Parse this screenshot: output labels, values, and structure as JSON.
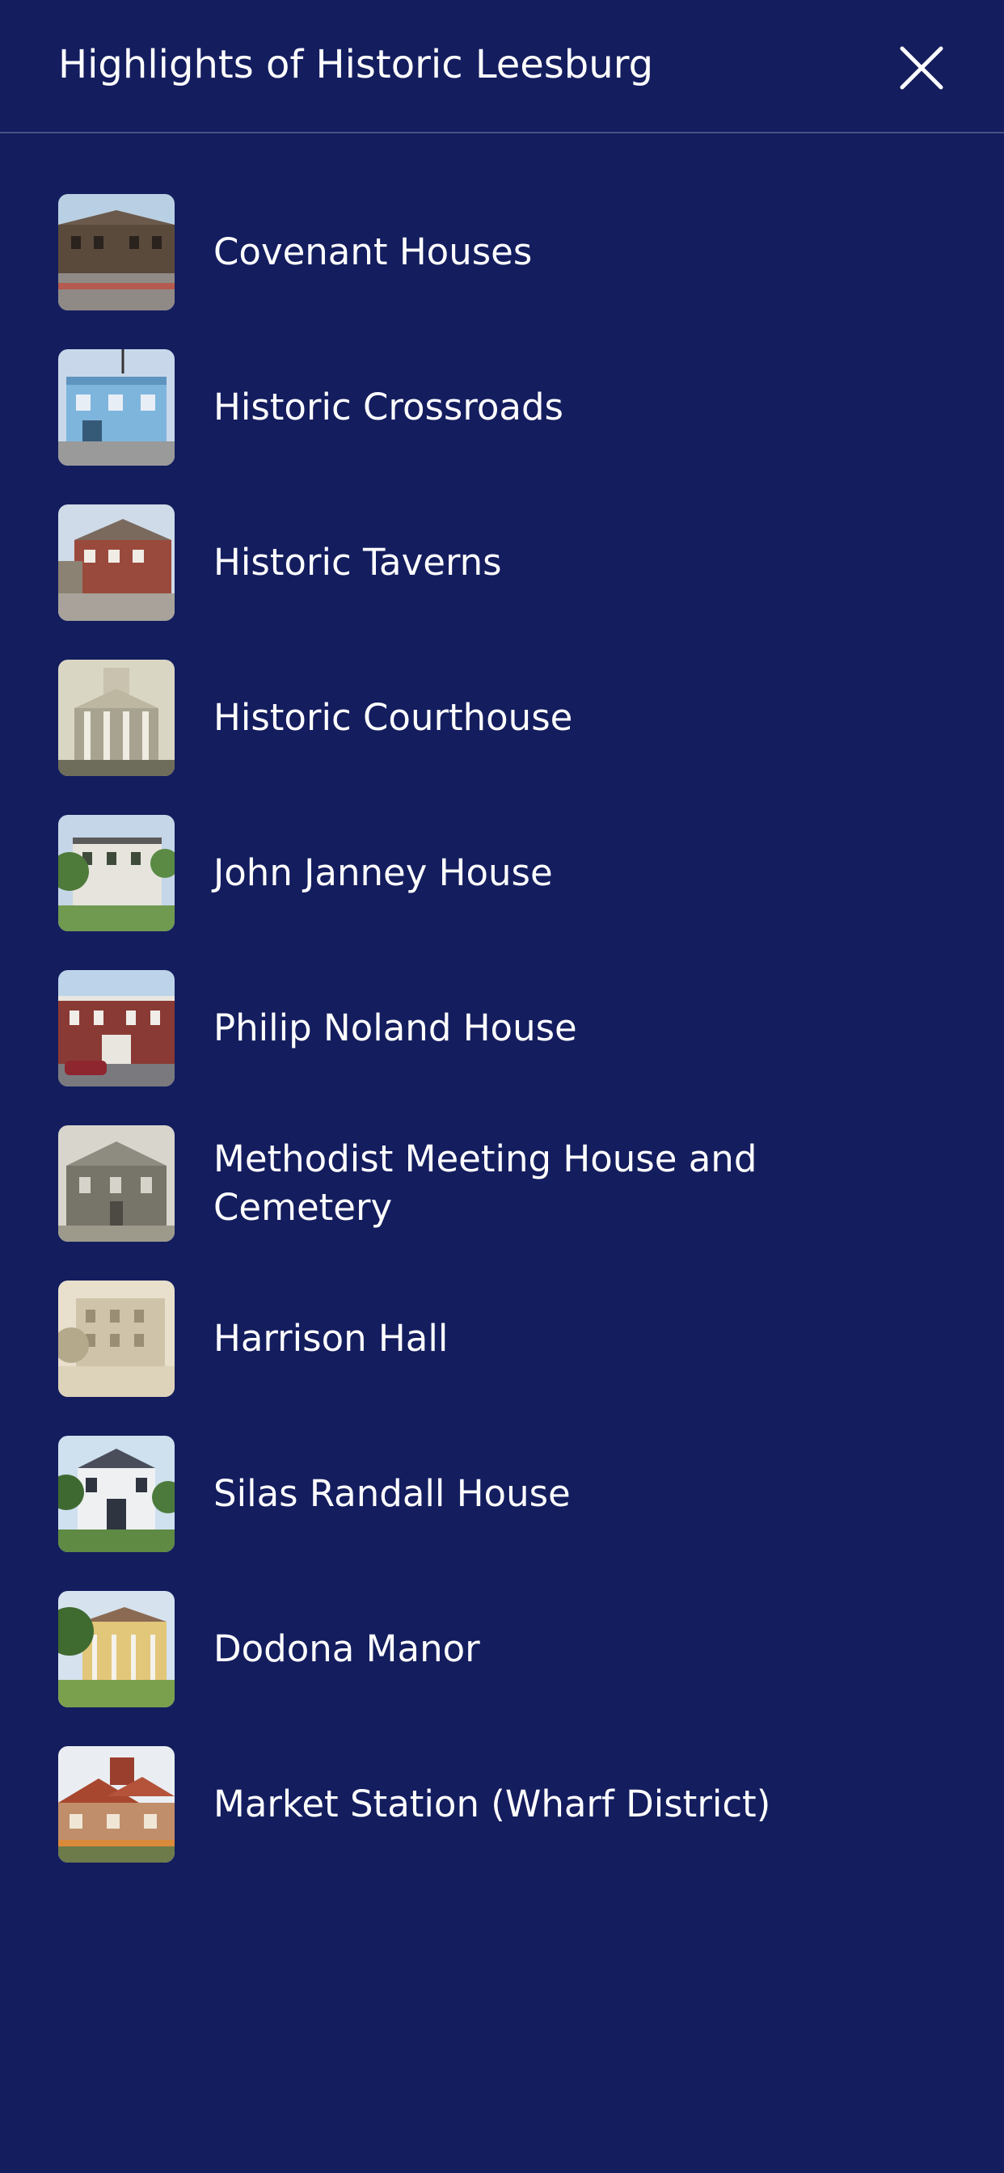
{
  "header": {
    "title": "Highlights of Historic Leesburg",
    "close_icon": "close-icon"
  },
  "colors": {
    "background": "#141d5e",
    "divider": "#4a5283",
    "text": "#ffffff"
  },
  "items": [
    {
      "label": "Covenant Houses",
      "thumb_icon": "covenant-houses-photo-thumbnail"
    },
    {
      "label": "Historic Crossroads",
      "thumb_icon": "historic-crossroads-photo-thumbnail"
    },
    {
      "label": "Historic Taverns",
      "thumb_icon": "historic-taverns-photo-thumbnail"
    },
    {
      "label": "Historic Courthouse",
      "thumb_icon": "historic-courthouse-photo-thumbnail"
    },
    {
      "label": "John Janney House",
      "thumb_icon": "john-janney-house-photo-thumbnail"
    },
    {
      "label": "Philip Noland House",
      "thumb_icon": "philip-noland-house-photo-thumbnail"
    },
    {
      "label": "Methodist Meeting House and Cemetery",
      "thumb_icon": "methodist-meeting-house-photo-thumbnail"
    },
    {
      "label": "Harrison Hall",
      "thumb_icon": "harrison-hall-photo-thumbnail"
    },
    {
      "label": "Silas Randall House",
      "thumb_icon": "silas-randall-house-photo-thumbnail"
    },
    {
      "label": "Dodona Manor",
      "thumb_icon": "dodona-manor-photo-thumbnail"
    },
    {
      "label": "Market Station (Wharf District)",
      "thumb_icon": "market-station-photo-thumbnail"
    }
  ]
}
